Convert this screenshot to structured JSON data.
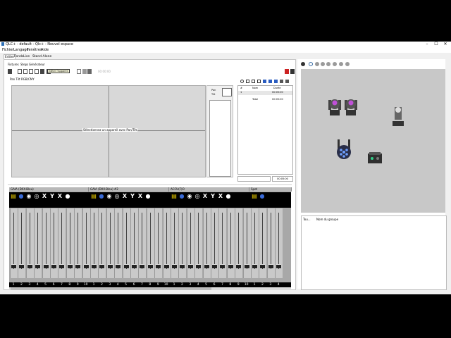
{
  "window": {
    "title": "QLC+ - default - Qlc+ - Nouvel espace",
    "buttons": [
      "–",
      "☐",
      "✕"
    ]
  },
  "menu": [
    "Fichier",
    "Langage",
    "Fenêtres",
    "Aide"
  ],
  "top_tabs": [
    "Editer",
    "Fonds",
    "Live",
    "Stand Alone"
  ],
  "subtabs": [
    "Fixtures",
    "Steps",
    "Générateur"
  ],
  "tooltip": "Editer l'appareil",
  "timer_readout": "00:00:00",
  "position_tabs": [
    "Pan Tilt",
    "RGB/CMY"
  ],
  "pan_message": "Sélectionnez un appareil avec Pan/Tilt",
  "pantilt": {
    "pan": "Pan",
    "tilt": "Tilt"
  },
  "steps": {
    "headers": [
      "#",
      "Nom",
      "Durée"
    ],
    "rows": [
      {
        "num": "1",
        "name": "",
        "dur": "00:05:00"
      }
    ],
    "total_label": "Total",
    "total_value": "00:05:00",
    "footer_time": "00:05:00"
  },
  "console": {
    "groups": [
      "GAIA (DXX-Bleu)",
      "GAIA (DXX-Bleu) #2",
      "ACCU(F)O",
      "Spot"
    ],
    "icon_colors": {
      "yellow": "#f2d300",
      "blue": "#3a6bd8",
      "white": "#ffffff",
      "red": "#d22"
    },
    "numbers": [
      "1",
      "2",
      "3",
      "4",
      "5",
      "6",
      "7",
      "8",
      "9",
      "10",
      "1",
      "2",
      "3",
      "4",
      "5",
      "6",
      "7",
      "8",
      "9",
      "10",
      "1",
      "2",
      "3",
      "4",
      "5",
      "6",
      "7",
      "8",
      "9",
      "10",
      "1",
      "2",
      "3",
      "4"
    ]
  },
  "groups_table": {
    "col1": "Tou...",
    "col2": "Nom du groupe"
  }
}
